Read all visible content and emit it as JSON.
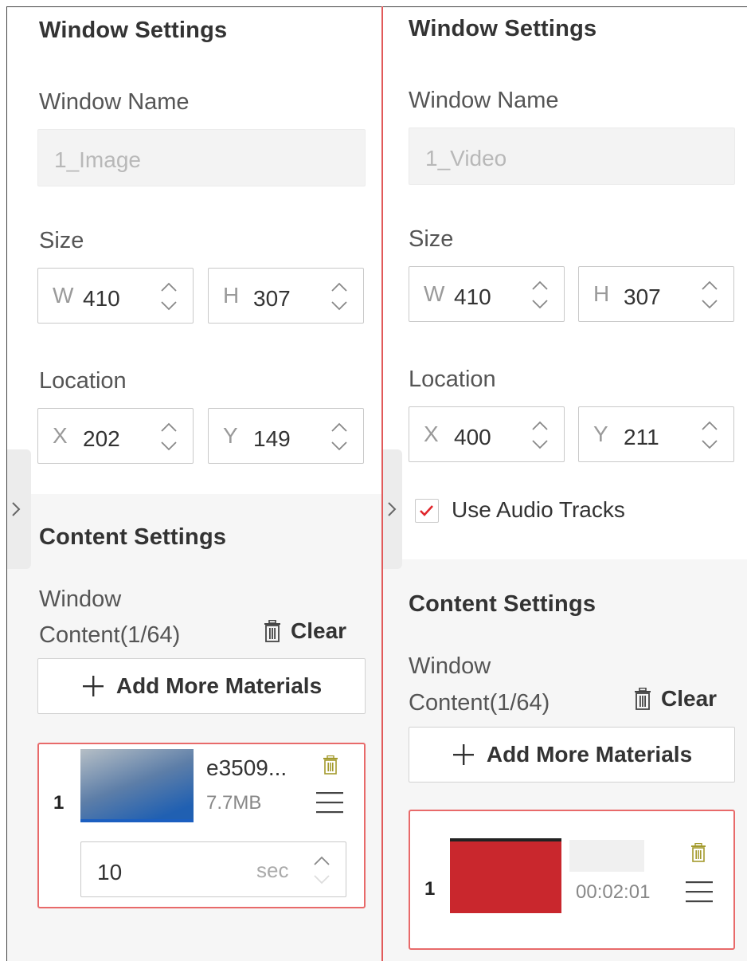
{
  "left_panel": {
    "window_settings_title": "Window Settings",
    "window_name_label": "Window Name",
    "window_name_value": "1_Image",
    "size_label": "Size",
    "width": {
      "prefix": "W",
      "value": "410"
    },
    "height": {
      "prefix": "H",
      "value": "307"
    },
    "location_label": "Location",
    "x": {
      "prefix": "X",
      "value": "202"
    },
    "y": {
      "prefix": "Y",
      "value": "149"
    },
    "content_settings_title": "Content Settings",
    "window_content_line1": "Window",
    "window_content_line2": "Content(1/64)",
    "clear_label": "Clear",
    "add_materials_label": "Add More Materials",
    "material": {
      "index": "1",
      "file_name": "e3509...",
      "file_size": "7.7MB",
      "duration_value": "10",
      "duration_unit": "sec"
    }
  },
  "right_panel": {
    "window_settings_title": "Window Settings",
    "window_name_label": "Window Name",
    "window_name_value": "1_Video",
    "size_label": "Size",
    "width": {
      "prefix": "W",
      "value": "410"
    },
    "height": {
      "prefix": "H",
      "value": "307"
    },
    "location_label": "Location",
    "x": {
      "prefix": "X",
      "value": "400"
    },
    "y": {
      "prefix": "Y",
      "value": "211"
    },
    "use_audio_label": "Use Audio Tracks",
    "use_audio_checked": true,
    "content_settings_title": "Content Settings",
    "window_content_line1": "Window",
    "window_content_line2": "Content(1/64)",
    "clear_label": "Clear",
    "add_materials_label": "Add More Materials",
    "material": {
      "index": "1",
      "duration": "00:02:01"
    }
  },
  "colors": {
    "accent_red": "#e15a5a",
    "video_thumb_red": "#c9272d",
    "trash_icon_yellow": "#a39a2c"
  }
}
